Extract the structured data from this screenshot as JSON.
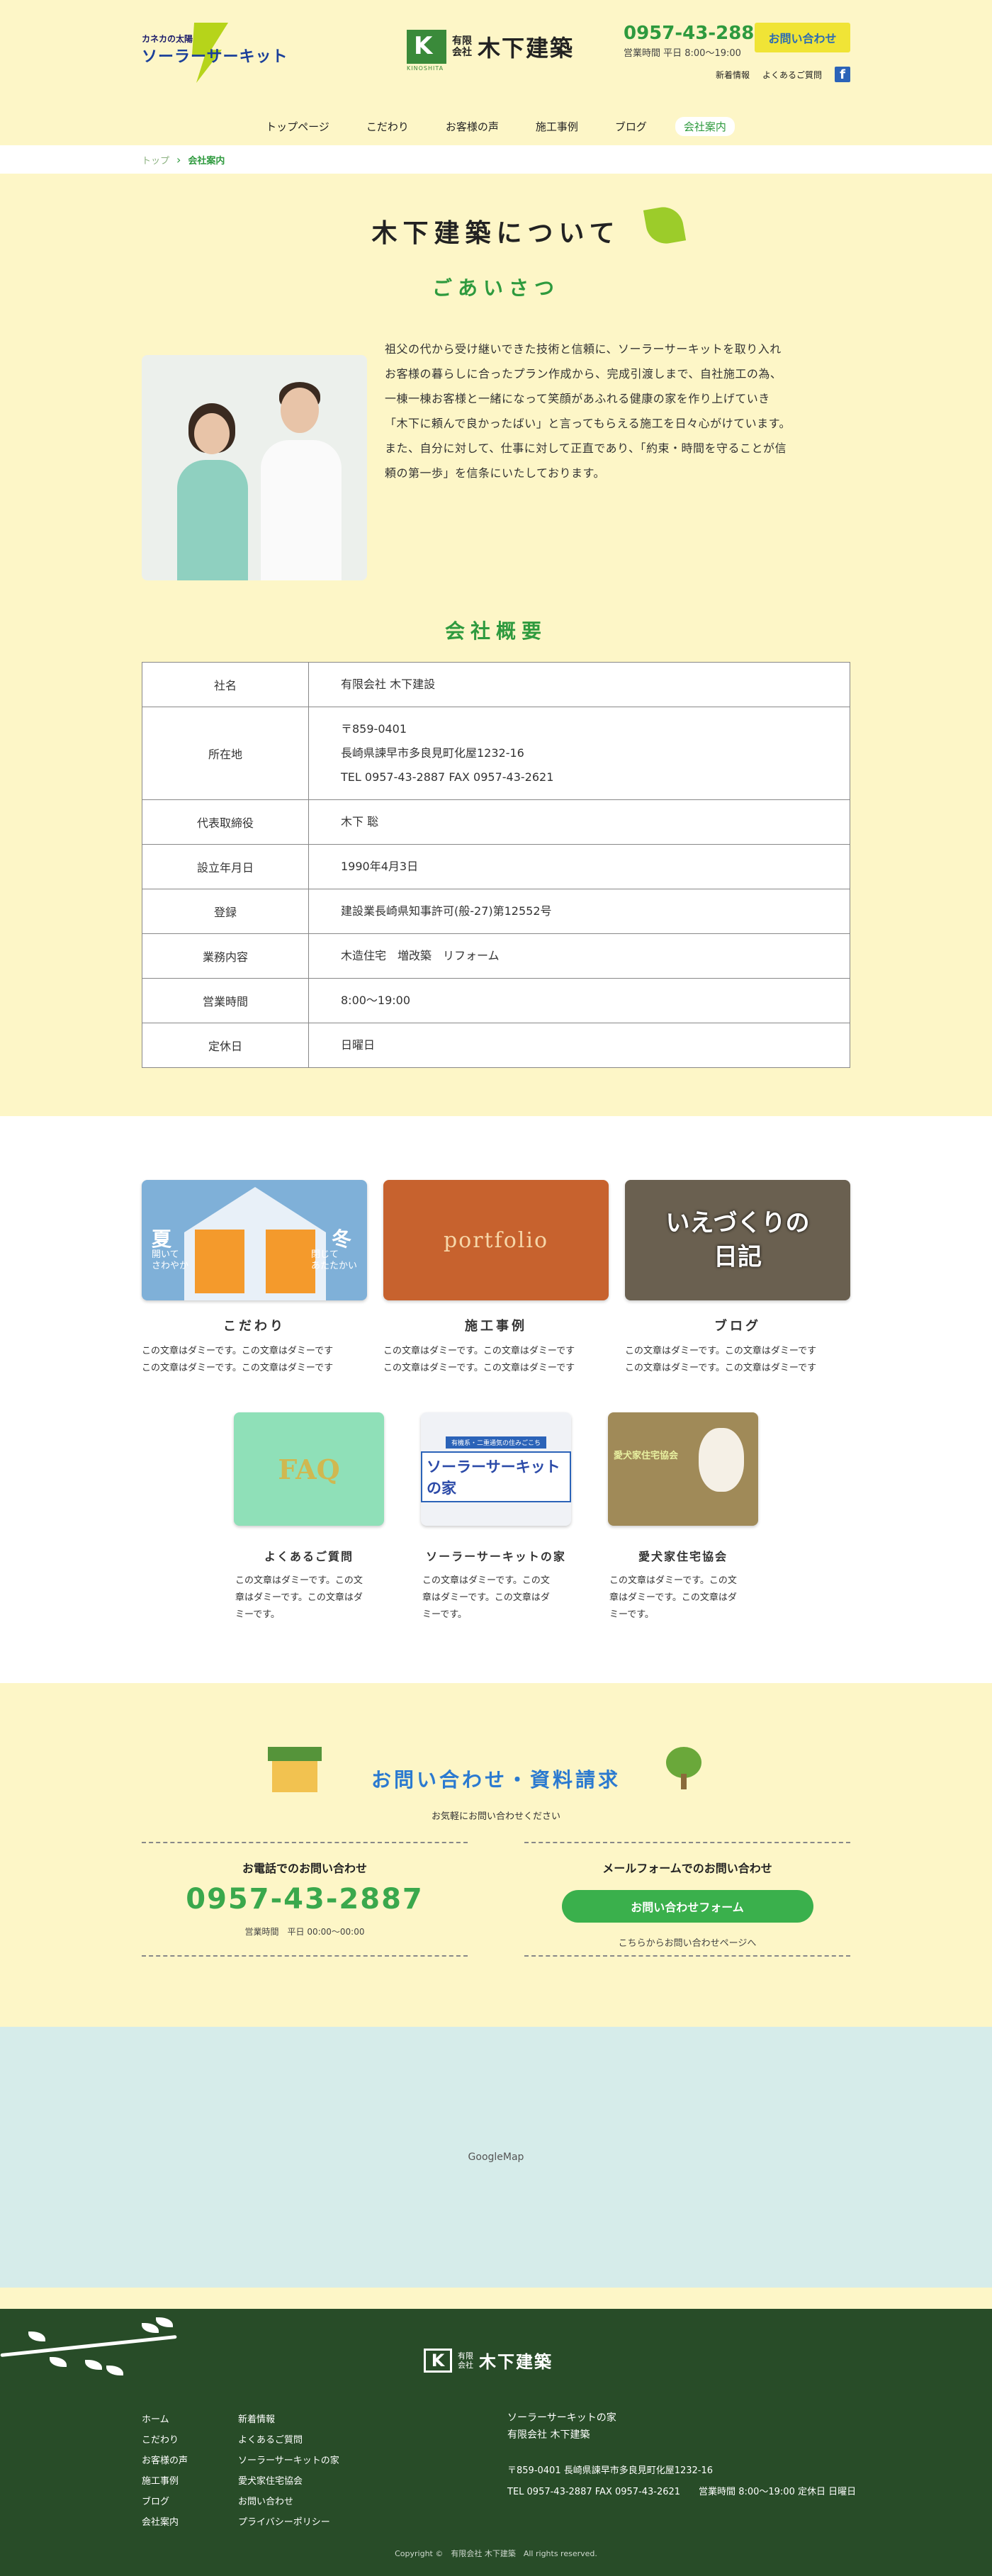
{
  "header": {
    "solar_logo_line1": "カネカの太陽",
    "solar_logo_line2": "ソーラーサーキット",
    "kinoshita_mark_sub": "KINOSHITA",
    "kinoshita_corp_top": "有限",
    "kinoshita_corp_bottom": "会社",
    "kinoshita_name": "木下建築",
    "phone": "0957-43-2887",
    "hours": "営業時間 平日 8:00〜19:00",
    "contact_button": "お問い合わせ",
    "links": [
      "新着情報",
      "よくあるご質問"
    ],
    "fb_label": "f"
  },
  "nav": {
    "items": [
      "トップページ",
      "こだわり",
      "お客様の声",
      "施工事例",
      "ブログ",
      "会社案内"
    ]
  },
  "breadcrumb": {
    "home": "トップ",
    "separator": "›",
    "current": "会社案内"
  },
  "about": {
    "title": "木下建築について",
    "greeting_title": "ごあいさつ",
    "greeting_lines": [
      "祖父の代から受け継いできた技術と信頼に、ソーラーサーキットを取り入れ",
      "お客様の暮らしに合ったプラン作成から、完成引渡しまで、自社施工の為、",
      "一棟一棟お客様と一緒になって笑顔があふれる健康の家を作り上げていき",
      "「木下に頼んで良かったばい」と言ってもらえる施工を日々心がけています。",
      "また、自分に対して、仕事に対して正直であり、「約束・時間を守ることが信",
      "頼の第一歩」を信条にいたしております。"
    ],
    "overview_title": "会社概要",
    "overview": [
      {
        "label": "社名",
        "value": [
          "有限会社 木下建設"
        ]
      },
      {
        "label": "所在地",
        "value": [
          "〒859-0401",
          "長崎県諫早市多良見町化屋1232-16",
          "TEL 0957-43-2887 FAX 0957-43-2621"
        ]
      },
      {
        "label": "代表取締役",
        "value": [
          "木下 聡"
        ]
      },
      {
        "label": "設立年月日",
        "value": [
          "1990年4月3日"
        ]
      },
      {
        "label": "登録",
        "value": [
          "建設業長崎県知事許可(般-27)第12552号"
        ]
      },
      {
        "label": "業務内容",
        "value": [
          "木造住宅　増改築　リフォーム"
        ]
      },
      {
        "label": "営業時間",
        "value": [
          "8:00〜19:00"
        ]
      },
      {
        "label": "定休日",
        "value": [
          "日曜日"
        ]
      }
    ]
  },
  "cards": {
    "row1": [
      {
        "title": "こだわり",
        "text": "この文章はダミーです。この文章はダミーです\nこの文章はダミーです。この文章はダミーです"
      },
      {
        "title": "施工事例",
        "text": "この文章はダミーです。この文章はダミーです\nこの文章はダミーです。この文章はダミーです"
      },
      {
        "title": "ブログ",
        "text": "この文章はダミーです。この文章はダミーです\nこの文章はダミーです。この文章はダミーです"
      }
    ],
    "row2": [
      {
        "title": "よくあるご質問",
        "text": "この文章はダミーです。この文\n章はダミーです。この文章はダ\nミーです。"
      },
      {
        "title": "ソーラーサーキットの家",
        "text": "この文章はダミーです。この文\n章はダミーです。この文章はダ\nミーです。"
      },
      {
        "title": "愛犬家住宅協会",
        "text": "この文章はダミーです。この文\n章はダミーです。この文章はダ\nミーです。"
      }
    ],
    "thumbs": {
      "kodawari_summer": "夏",
      "kodawari_summer_sub": "開いて\nさわやか",
      "kodawari_winter": "冬",
      "kodawari_winter_sub": "閉じて\nあたたかい",
      "portfolio": "portfolio",
      "blog": "いえづくりの\n日記",
      "faq": "FAQ",
      "solar_band1": "有機系・二重通気の住みごこち",
      "solar_band2": "ソーラーサーキットの家",
      "dog_sign": "愛犬家住宅協会"
    }
  },
  "contact": {
    "title": "お問い合わせ・資料請求",
    "subtitle": "お気軽にお問い合わせください",
    "phone_heading": "お電話でのお問い合わせ",
    "phone": "0957-43-2887",
    "phone_hours": "営業時間　平日 00:00〜00:00",
    "form_heading": "メールフォームでのお問い合わせ",
    "form_button": "お問い合わせフォーム",
    "form_note": "こちらからお問い合わせページへ"
  },
  "map": {
    "label": "GoogleMap"
  },
  "footer": {
    "logo_mark": "K",
    "corp_top": "有限",
    "corp_bottom": "会社",
    "name": "木下建築",
    "nav1": [
      "ホーム",
      "こだわり",
      "お客様の声",
      "施工事例",
      "ブログ",
      "会社案内"
    ],
    "nav2": [
      "新着情報",
      "よくあるご質問",
      "ソーラーサーキットの家",
      "愛犬家住宅協会",
      "お問い合わせ",
      "プライバシーポリシー"
    ],
    "info_line1": "ソーラーサーキットの家",
    "info_line2": "有限会社 木下建築",
    "address": "〒859-0401 長崎県諫早市多良見町化屋1232-16",
    "tel": "TEL 0957-43-2887 FAX 0957-43-2621　　営業時間 8:00〜19:00 定休日 日曜日",
    "copyright": "Copyright ©　有限会社 木下建築　All rights reserved."
  }
}
